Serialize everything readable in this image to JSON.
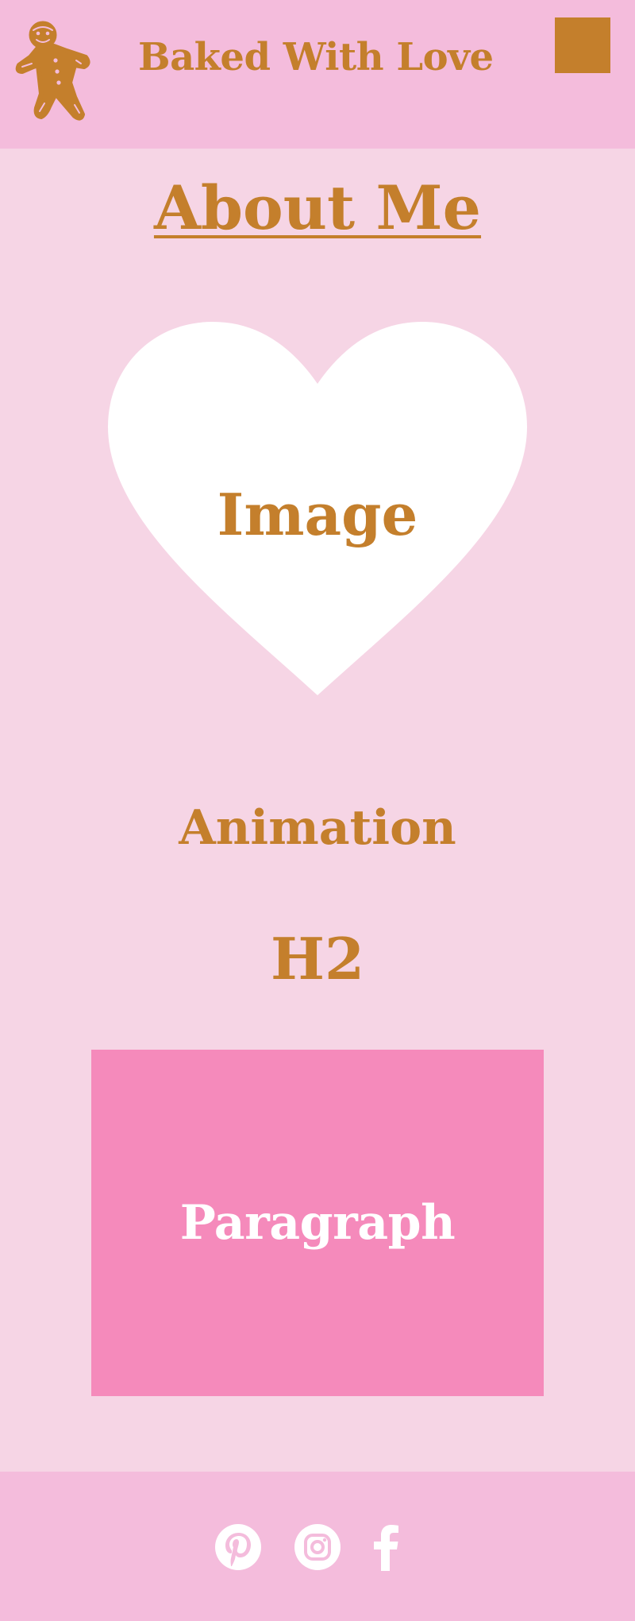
{
  "header": {
    "site_title": "Baked With Love",
    "logo_icon": "gingerbread-man-icon",
    "menu_icon": "menu-button"
  },
  "main": {
    "page_title": "About Me",
    "image_placeholder": "Image",
    "animation_label": "Animation",
    "h2_label": "H2",
    "paragraph_label": "Paragraph"
  },
  "footer": {
    "social": [
      {
        "name": "pinterest-icon"
      },
      {
        "name": "instagram-icon"
      },
      {
        "name": "facebook-icon"
      }
    ]
  },
  "colors": {
    "header_bg": "#f4bcdc",
    "page_bg": "#f6d5e5",
    "accent": "#c47f2c",
    "paragraph_bg": "#f58abb",
    "white": "#ffffff"
  }
}
